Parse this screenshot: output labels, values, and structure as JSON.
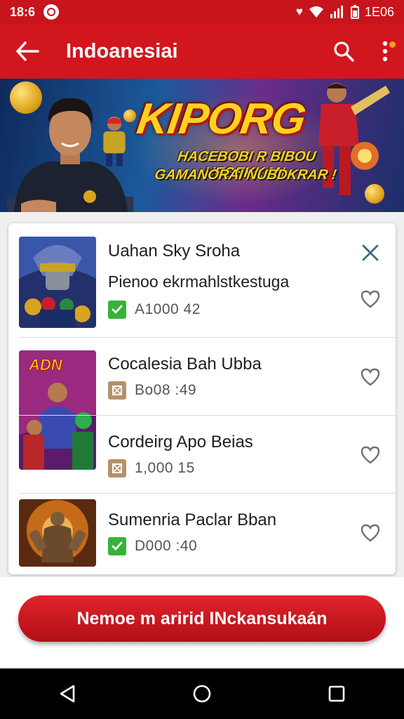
{
  "status_bar": {
    "time": "18:6",
    "right_text": "1E06",
    "icons": [
      "heart-icon",
      "wifi-icon",
      "signal-icon",
      "battery-icon"
    ]
  },
  "app_bar": {
    "title": "Indoanesiai",
    "back_icon": "arrow-left-icon",
    "search_icon": "search-icon",
    "more_icon": "more-vertical-icon"
  },
  "banner": {
    "headline": "KIPORG",
    "tagline_line1": "HACEBOBI R BIBOU UEOEKKAN",
    "tagline_line2": "GAMANORAI NUBDKRAR !"
  },
  "list": {
    "items": [
      {
        "name": "Uahan Sky Sroha",
        "subtitle": "Pienoo ekrmahlstkestuga",
        "meta": "A1000 42",
        "meta_icon": "check-icon",
        "meta_color": "#37b23a",
        "action": "close-icon",
        "thumb_text": ""
      },
      {
        "name": "Cocalesia Bah Ubba",
        "subtitle": "",
        "meta": "Bo08 :49",
        "meta_icon": "box-icon",
        "meta_color": "#b5916a",
        "action": "heart-icon",
        "thumb_text": "ADN"
      },
      {
        "name": "Cordeirg Apo Beias",
        "subtitle": "",
        "meta": "1,000 15",
        "meta_icon": "box-icon",
        "meta_color": "#b5916a",
        "action": "heart-icon",
        "thumb_text": ""
      },
      {
        "name": "Sumenria Paclar Bban",
        "subtitle": "",
        "meta": "D000 :40",
        "meta_icon": "check-icon",
        "meta_color": "#37b23a",
        "action": "heart-icon",
        "thumb_text": ""
      }
    ]
  },
  "cta": {
    "label": "Nemoe m aririd INckansukaán"
  },
  "nav": {
    "back": "nav-back-icon",
    "home": "nav-home-icon",
    "recents": "nav-recents-icon"
  },
  "colors": {
    "primary": "#d2161e",
    "status_bar": "#c8141c",
    "check": "#37b23a",
    "box": "#b5916a"
  }
}
